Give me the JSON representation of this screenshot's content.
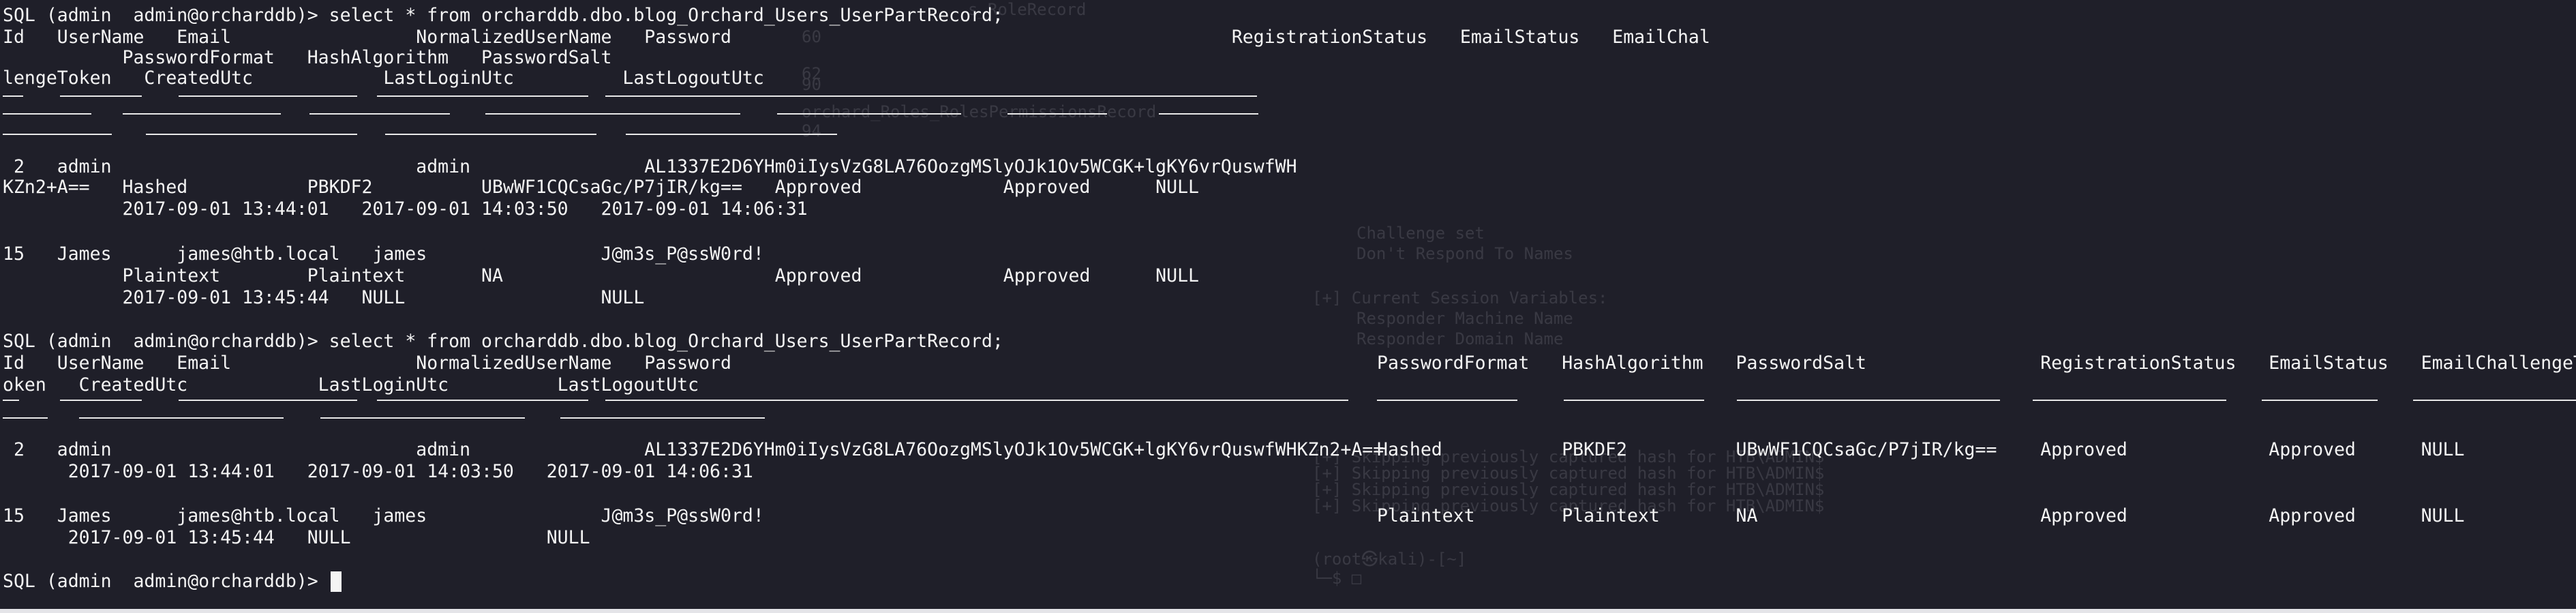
{
  "background": {
    "color": "#1f1f29",
    "ghost_lines": [
      "s_RoleRecord",
      "60",
      "62",
      "90",
      "orchard_Roles_RolesPermissionsRecord",
      "94",
      "Challenge set",
      "Don't Respond To Names",
      "[+] Current Session Variables:",
      "Responder Machine Name",
      "Responder Domain Name",
      "[+] Skipping previously captured hash for HTB\\ADMIN$",
      "[+] Skipping previously captured hash for HTB\\ADMIN$",
      "[+] Skipping previously captured hash for HTB\\ADMIN$",
      "[+] Skipping previously captured hash for HTB\\ADMIN$",
      "(root㉿kali)-[~]",
      "└─$ □"
    ]
  },
  "terminal": {
    "prompt": "SQL (admin  admin@orcharddb)> ",
    "query1": {
      "command": "select * from orcharddb.dbo.blog_Orchard_Users_UserPartRecord;",
      "header_lines": [
        "Id   UserName   Email                 NormalizedUserName   Password                                              RegistrationStatus   EmailStatus   EmailChal",
        "           PasswordFormat   HashAlgorithm   PasswordSalt",
        "lengeToken   CreatedUtc            LastLoginUtc          LastLogoutUtc"
      ],
      "rows": [
        [
          " 2   admin                            admin                AL1337E2D6YHm0iIysVzG8LA76OozgMSlyOJk1Ov5WCGK+lgKY6vrQuswfWH",
          "KZn2+A==   Hashed           PBKDF2          UBwWF1CQCsaGc/P7jIR/kg==   Approved             Approved      NULL",
          "           2017-09-01 13:44:01   2017-09-01 14:03:50   2017-09-01 14:06:31"
        ],
        [
          "15   James      james@htb.local   james                J@m3s_P@ssW0rd!",
          "           Plaintext        Plaintext       NA                         Approved             Approved      NULL",
          "           2017-09-01 13:45:44   NULL                  NULL"
        ]
      ]
    },
    "query2": {
      "command": "select * from orcharddb.dbo.blog_Orchard_Users_UserPartRecord;",
      "header_lines": [
        "Id   UserName   Email                 NormalizedUserName   Password",
        "oken   CreatedUtc            LastLoginUtc          LastLogoutUtc"
      ],
      "header_right": "PasswordFormat   HashAlgorithm   PasswordSalt                RegistrationStatus   EmailStatus   EmailChallengeT",
      "rows": [
        {
          "left": " 2   admin                            admin                AL1337E2D6YHm0iIysVzG8LA76OozgMSlyOJk1Ov5WCGK+lgKY6vrQuswfWHKZn2+A==",
          "right": "Hashed           PBKDF2          UBwWF1CQCsaGc/P7jIR/kg==    Approved             Approved      NULL",
          "second": "      2017-09-01 13:44:01   2017-09-01 14:03:50   2017-09-01 14:06:31"
        },
        {
          "left": "15   James      james@htb.local   james                J@m3s_P@ssW0rd!",
          "right": "Plaintext        Plaintext       NA                          Approved             Approved      NULL",
          "second": "      2017-09-01 13:45:44   NULL                  NULL"
        }
      ]
    }
  }
}
